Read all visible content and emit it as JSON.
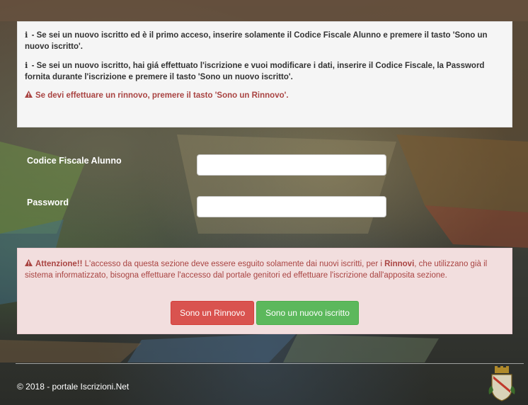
{
  "info": {
    "line1_prefix": "i",
    "line1_text": " - Se sei un nuovo iscritto ed è il primo acceso, inserire solamente il Codice Fiscale Alunno e premere il tasto 'Sono un nuovo iscritto'.",
    "line2_prefix": "i",
    "line2_text": " - Se sei un nuovo iscritto, hai giá effettuato l'iscrizione e vuoi modificare i dati, inserire il Codice Fiscale, la Password fornita durante l'iscrizione e premere il tasto 'Sono un nuovo iscritto'.",
    "warning_text": "Se devi effettuare un rinnovo, premere il tasto 'Sono un Rinnovo'."
  },
  "form": {
    "codice_label": "Codice Fiscale Alunno",
    "codice_value": "",
    "password_label": "Password",
    "password_value": ""
  },
  "alert": {
    "title": "Attenzione!!",
    "text_part1": " L'accesso da questa sezione deve essere esguito solamente dai nuovi iscritti, per i ",
    "bold_word": "Rinnovi",
    "text_part2": ", che utilizzano già il sistema informatizzato, bisogna effettuare l'accesso dal portale genitori ed effettuare l'iscrizione dall'apposita sezione."
  },
  "buttons": {
    "rinnovo": "Sono un Rinnovo",
    "nuovo": "Sono un nuovo iscritto"
  },
  "footer": {
    "copyright": "© 2018 - portale Iscrizioni.Net"
  },
  "colors": {
    "danger": "#d9534f",
    "success": "#5cb85c",
    "alert_bg": "#f2dede",
    "alert_text": "#a94442"
  }
}
